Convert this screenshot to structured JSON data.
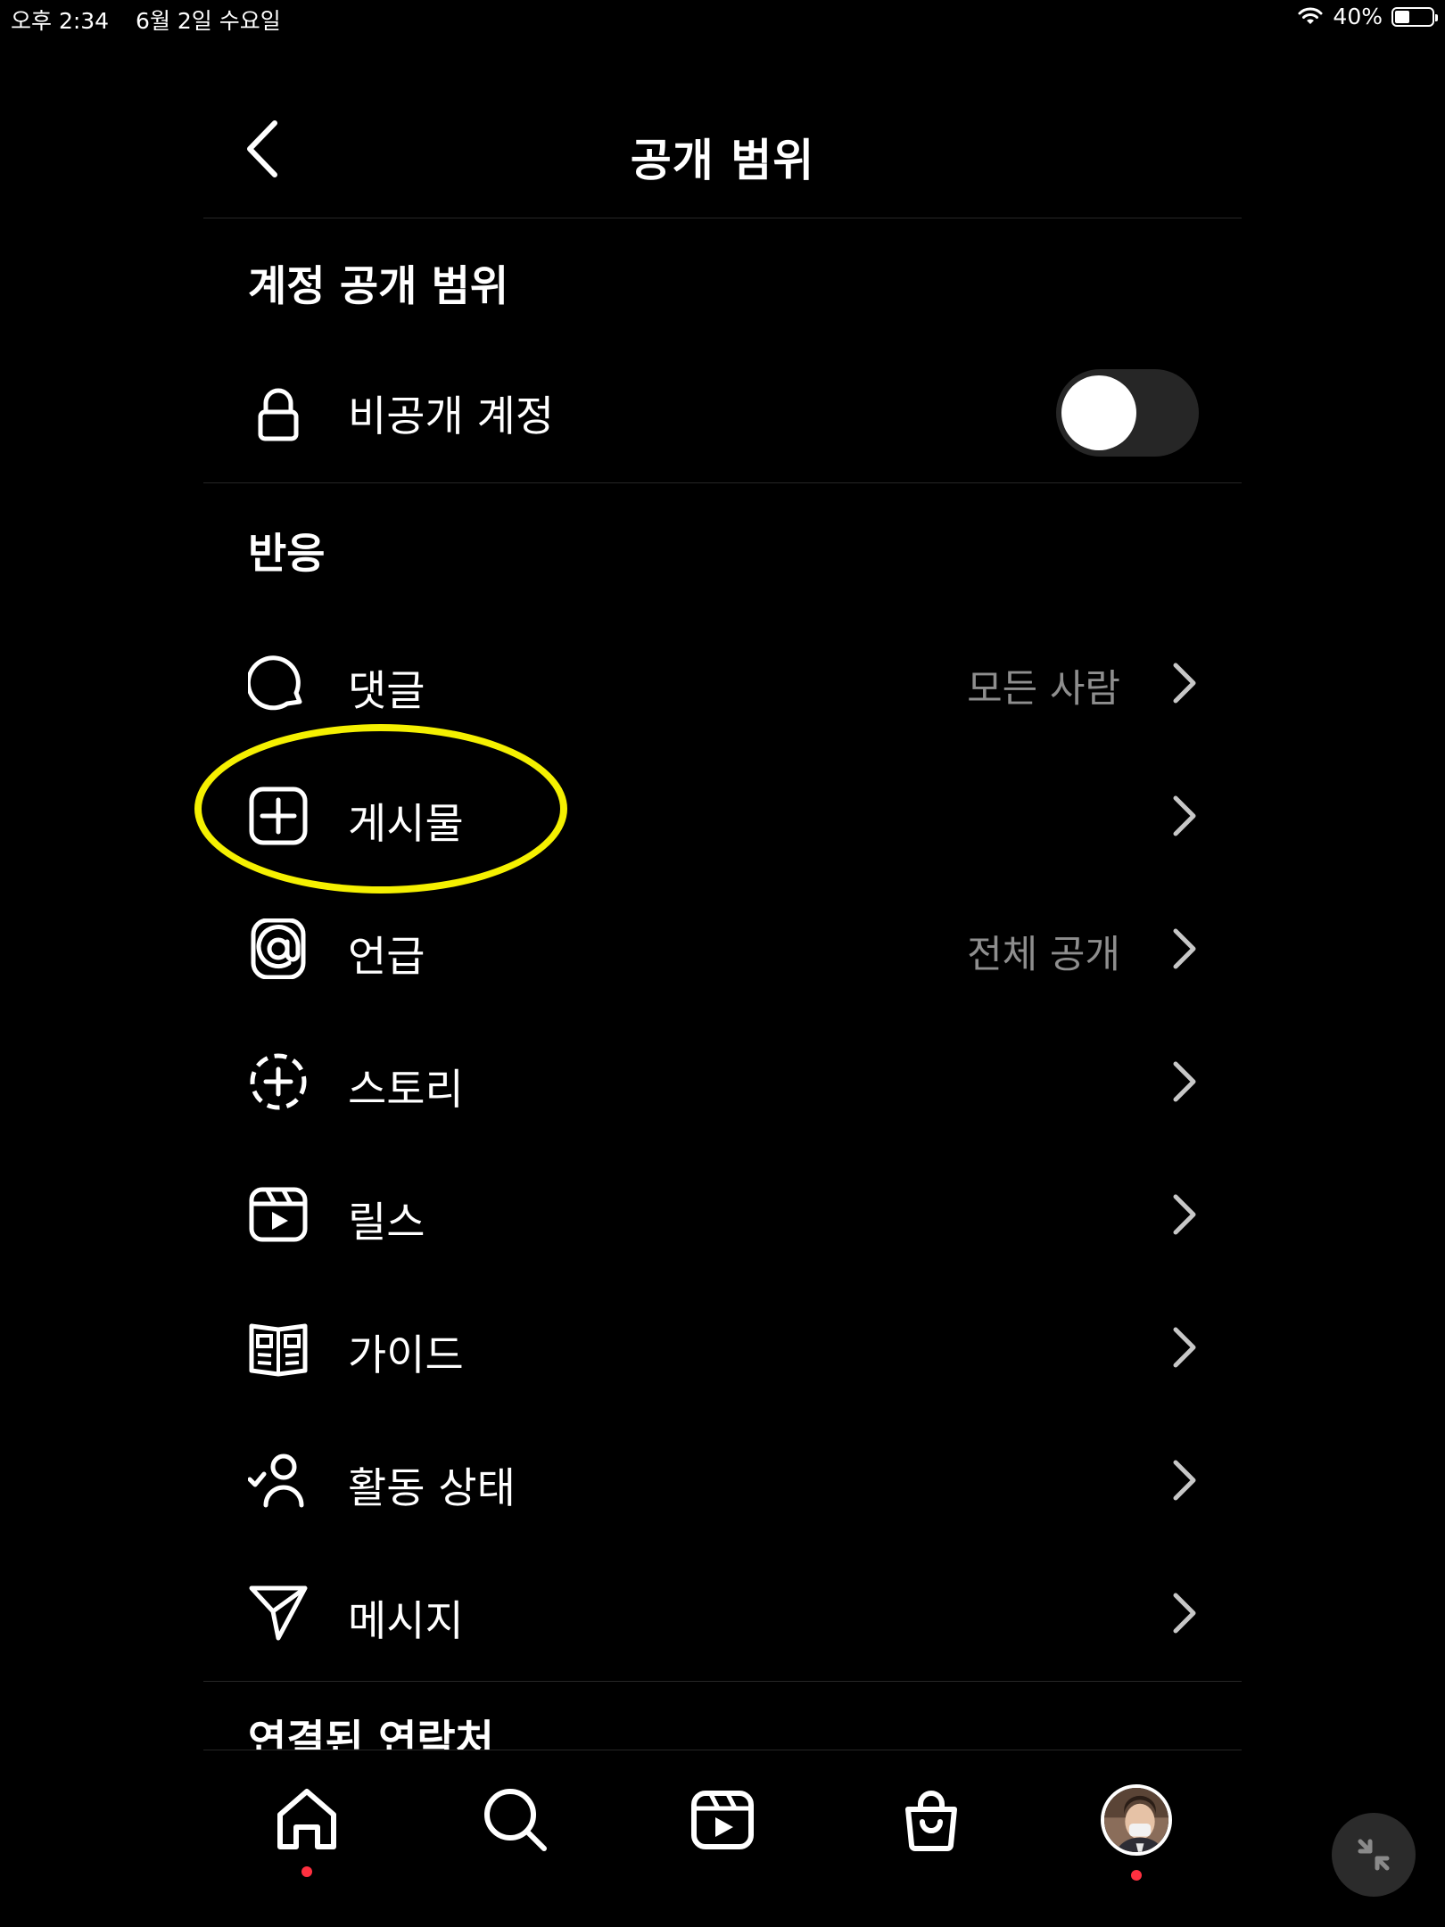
{
  "status_bar": {
    "time": "오후 2:34",
    "date": "6월 2일 수요일",
    "battery": "40%",
    "battery_level": 0.4,
    "wifi_icon": "wifi-icon",
    "battery_icon": "battery-icon"
  },
  "header": {
    "title": "공개 범위",
    "back_icon": "chevron-left-icon"
  },
  "account_section": {
    "title": "계정 공개 범위",
    "private_account": {
      "label": "비공개 계정",
      "icon": "lock-icon",
      "enabled": false
    }
  },
  "interactions_section": {
    "title": "반응",
    "items": [
      {
        "label": "댓글",
        "value": "모든 사람",
        "icon": "comment-icon"
      },
      {
        "label": "게시물",
        "value": "",
        "icon": "add-post-icon"
      },
      {
        "label": "언급",
        "value": "전체 공개",
        "icon": "mention-icon"
      },
      {
        "label": "스토리",
        "value": "",
        "icon": "story-add-icon"
      },
      {
        "label": "릴스",
        "value": "",
        "icon": "reels-icon"
      },
      {
        "label": "가이드",
        "value": "",
        "icon": "guide-icon"
      },
      {
        "label": "활동 상태",
        "value": "",
        "icon": "activity-status-icon"
      },
      {
        "label": "메시지",
        "value": "",
        "icon": "send-message-icon"
      }
    ]
  },
  "connections_section": {
    "title": "연결된 연락처"
  },
  "tab_bar": {
    "tabs": [
      "home-icon",
      "search-icon",
      "reels-tab-icon",
      "shop-icon",
      "profile-avatar"
    ],
    "notification_dots": [
      true,
      false,
      false,
      false,
      true
    ]
  },
  "colors": {
    "background": "#000000",
    "text": "#ffffff",
    "secondary_text": "#8e8e8e",
    "divider": "#262626",
    "highlight": "#f5f000",
    "notification_dot": "#ff3040",
    "toggle_track": "#262626"
  }
}
